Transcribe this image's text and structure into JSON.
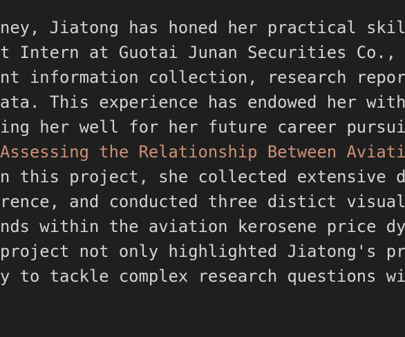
{
  "editor": {
    "lines": [
      {
        "text": "ney, Jiatong has honed her practical skill"
      },
      {
        "text": "t Intern at Guotai Junan Securities Co., L"
      },
      {
        "text": "nt information collection, research report"
      },
      {
        "text": "ata. This experience has endowed her with "
      },
      {
        "text": "ing her well for her future career pursuit"
      },
      {
        "text": "Assessing the Relationship Between Aviatio",
        "style": "string"
      },
      {
        "text": "n this project, she collected extensive da"
      },
      {
        "text": "rence, and conducted three distict visual "
      },
      {
        "text": "nds within the aviation kerosene price dyn"
      },
      {
        "text": "project not only highlighted Jiatong's pro"
      },
      {
        "text": "y to tackle complex research questions wit"
      }
    ]
  },
  "colors": {
    "background": "#1f1f1f",
    "text": "#d4d4d4",
    "string_text": "#ce9178"
  }
}
